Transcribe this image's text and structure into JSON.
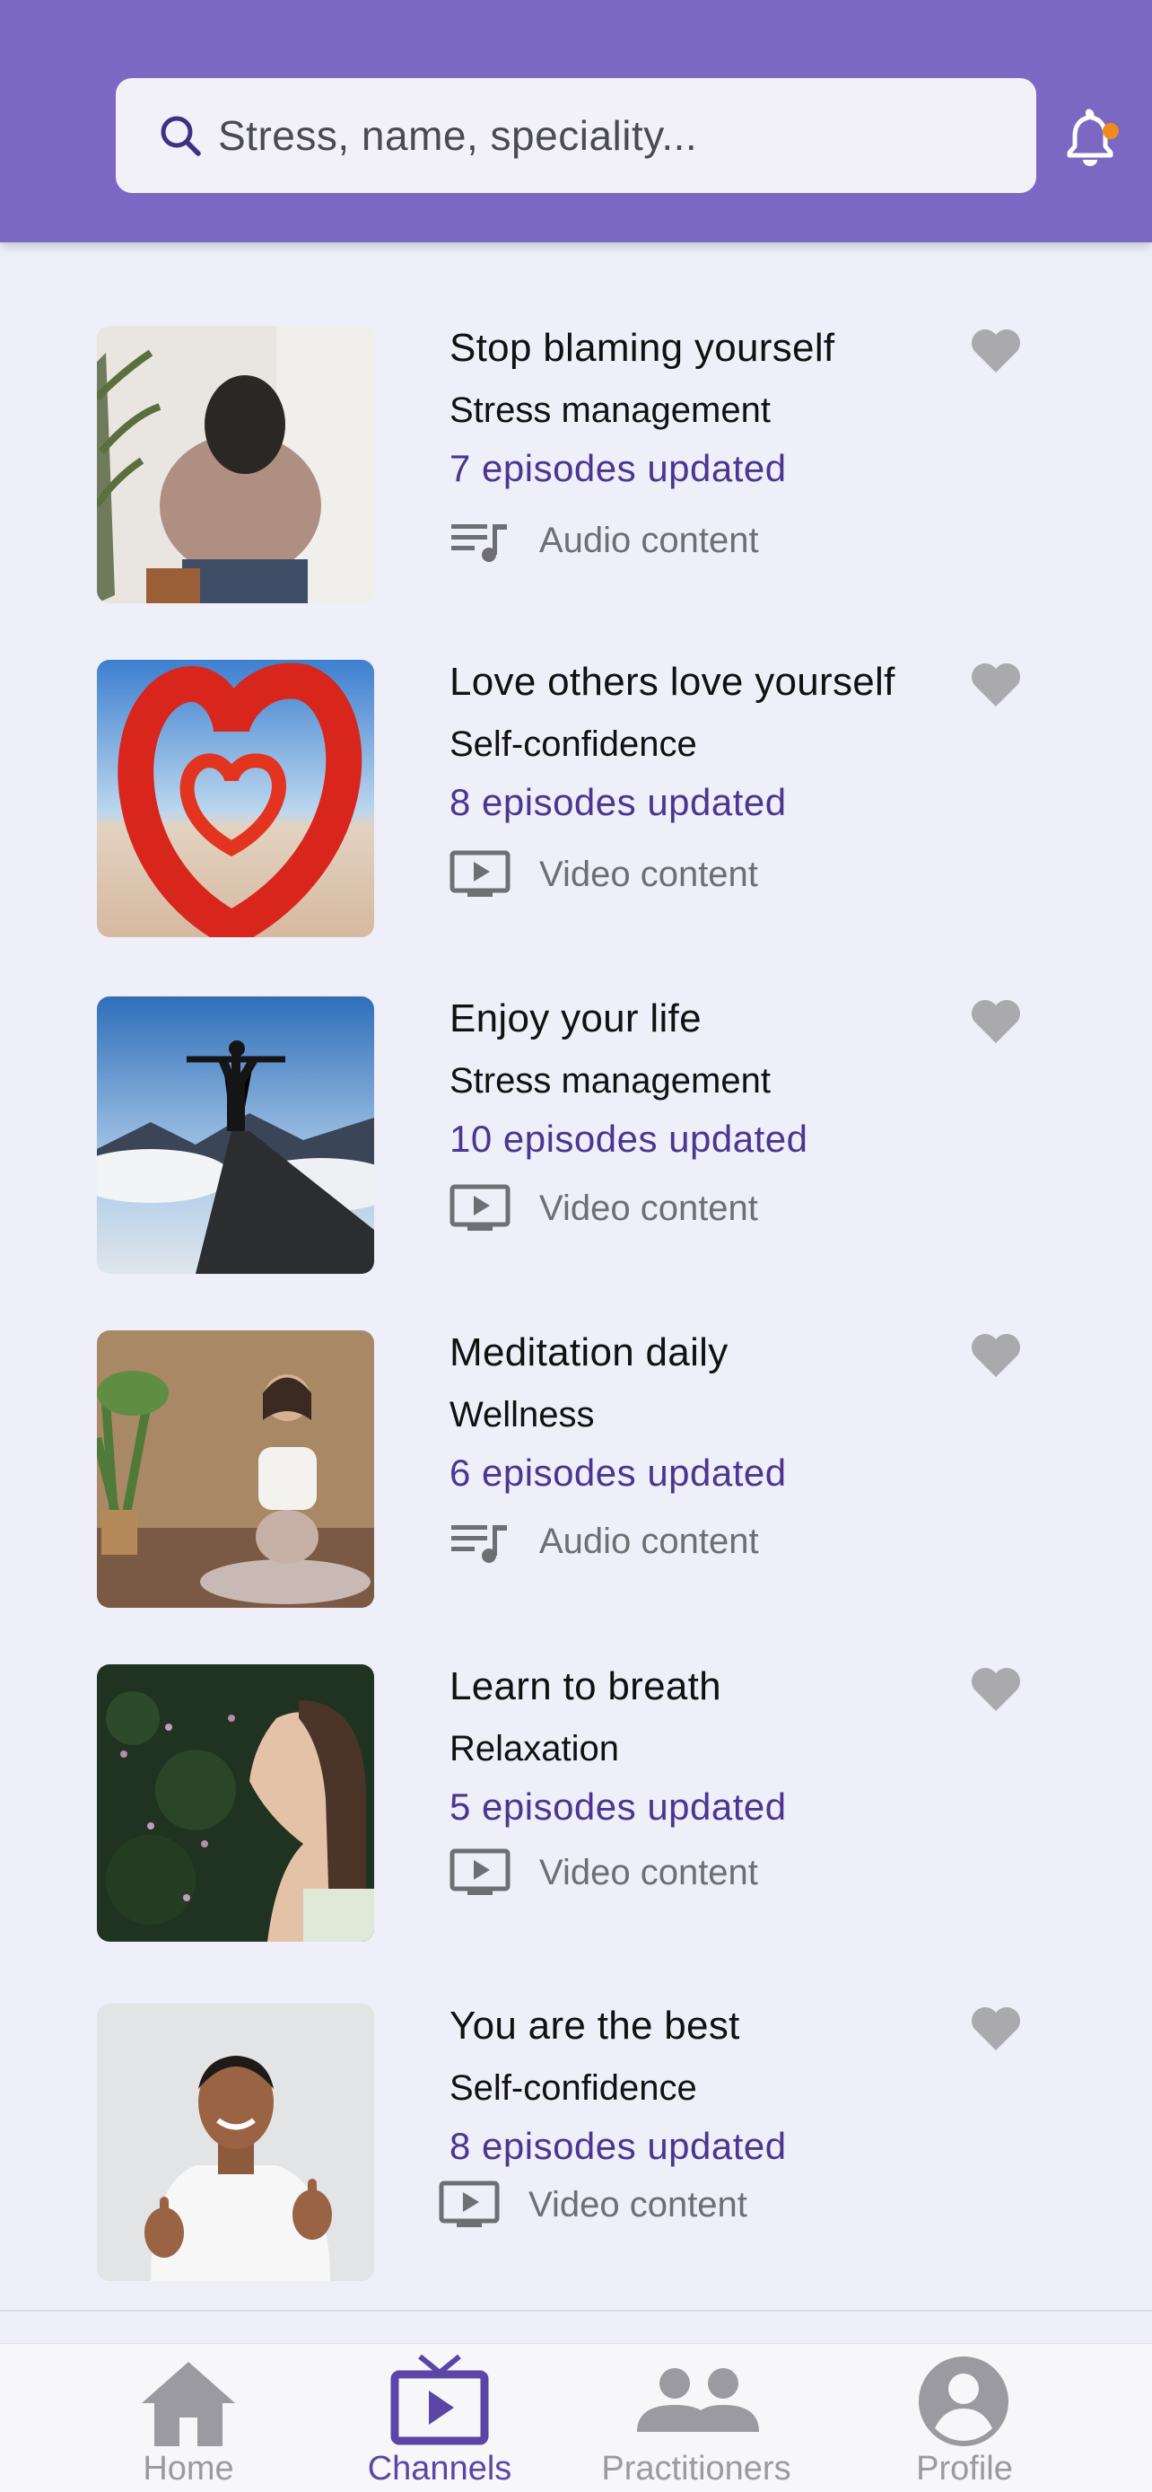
{
  "search": {
    "placeholder": "Stress, name, speciality..."
  },
  "colors": {
    "header": "#7b68c2",
    "accent": "#4b3591",
    "notification_dot": "#f08c1e",
    "heart": "#a9a9ae",
    "icon_gray": "#6e6e74"
  },
  "channels": [
    {
      "title": "Stop blaming yourself",
      "category": "Stress management",
      "episodes": "7 episodes updated",
      "content_type": "Audio content",
      "type_icon": "playlist-audio-icon",
      "image": "woman-holding-head-photo"
    },
    {
      "title": "Love others love yourself",
      "category": "Self-confidence",
      "episodes": "8 episodes updated",
      "content_type": "Video content",
      "type_icon": "video-play-icon",
      "image": "rose-petal-heart-photo"
    },
    {
      "title": "Enjoy your life",
      "category": "Stress management",
      "episodes": "10 episodes updated",
      "content_type": "Video content",
      "type_icon": "video-play-icon",
      "image": "person-on-mountain-bridge-photo"
    },
    {
      "title": "Meditation daily",
      "category": "Wellness",
      "episodes": "6 episodes updated",
      "content_type": "Audio content",
      "type_icon": "playlist-audio-icon",
      "image": "woman-meditating-photo"
    },
    {
      "title": "Learn to breath",
      "category": "Relaxation",
      "episodes": "5 episodes updated",
      "content_type": "Video content",
      "type_icon": "video-play-icon",
      "image": "woman-breathing-flowers-photo"
    },
    {
      "title": "You are the best",
      "category": "Self-confidence",
      "episodes": "8 episodes updated",
      "content_type": "Video content",
      "type_icon": "video-play-icon",
      "image": "man-thumbs-up-photo"
    }
  ],
  "tabs": [
    {
      "label": "Home",
      "icon": "home-icon",
      "active": false
    },
    {
      "label": "Channels",
      "icon": "tv-icon",
      "active": true
    },
    {
      "label": "Practitioners",
      "icon": "people-icon",
      "active": false
    },
    {
      "label": "Profile",
      "icon": "profile-icon",
      "active": false
    }
  ]
}
